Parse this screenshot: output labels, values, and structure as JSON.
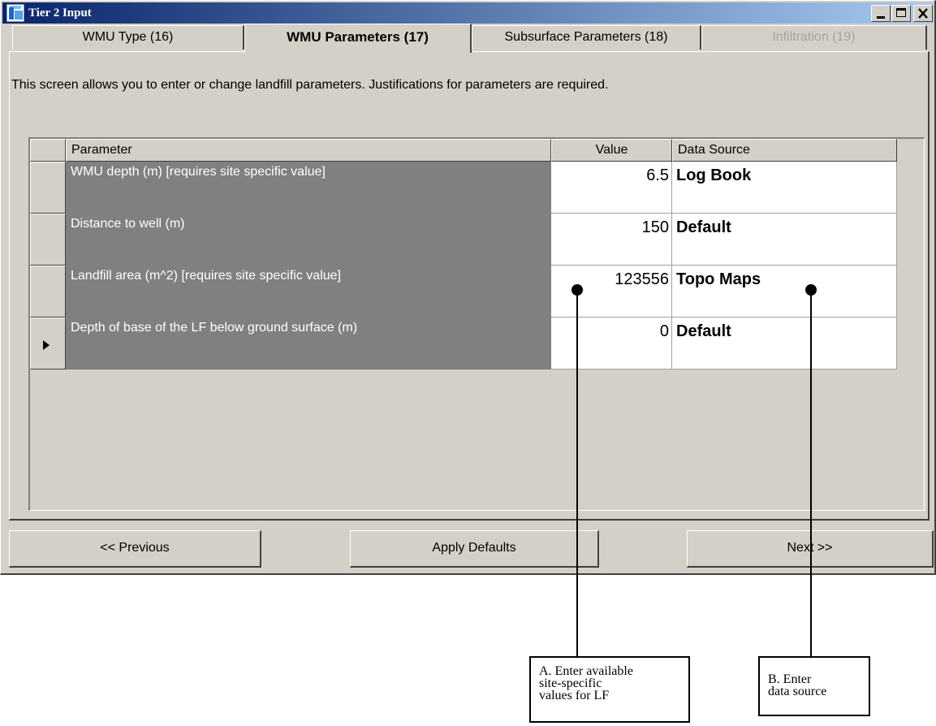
{
  "window": {
    "title": "Tier 2 Input"
  },
  "tabs": [
    {
      "label": "WMU Type (16)",
      "state": "normal"
    },
    {
      "label": "WMU Parameters (17)",
      "state": "selected"
    },
    {
      "label": "Subsurface Parameters (18)",
      "state": "normal"
    },
    {
      "label": "Infiltration (19)",
      "state": "disabled"
    }
  ],
  "instructions": "This screen allows you to enter or change landfill parameters.  Justifications for parameters are required.",
  "grid": {
    "columns": [
      "Parameter",
      "Value",
      "Data Source"
    ],
    "rows": [
      {
        "parameter": "WMU depth (m) [requires site specific value]",
        "value": "6.5",
        "source": "Log Book"
      },
      {
        "parameter": "Distance to well (m)",
        "value": "150",
        "source": "Default"
      },
      {
        "parameter": "Landfill area (m^2) [requires site specific value]",
        "value": "123556",
        "source": "Topo Maps"
      },
      {
        "parameter": "Depth of base of the LF below ground surface (m)",
        "value": "0",
        "source": "Default"
      }
    ],
    "current_row": 4
  },
  "buttons": {
    "previous": "<< Previous",
    "apply": "Apply Defaults",
    "next": "Next >>"
  },
  "callouts": {
    "a": [
      "A. Enter available",
      "site-specific",
      "values for LF"
    ],
    "b": [
      "B. Enter",
      "data source"
    ]
  },
  "colors": {
    "titlebar_start": "#0a246a",
    "titlebar_end": "#a6caf0",
    "dialog_face": "#d4d0c8",
    "parameter_cell": "#808080"
  }
}
